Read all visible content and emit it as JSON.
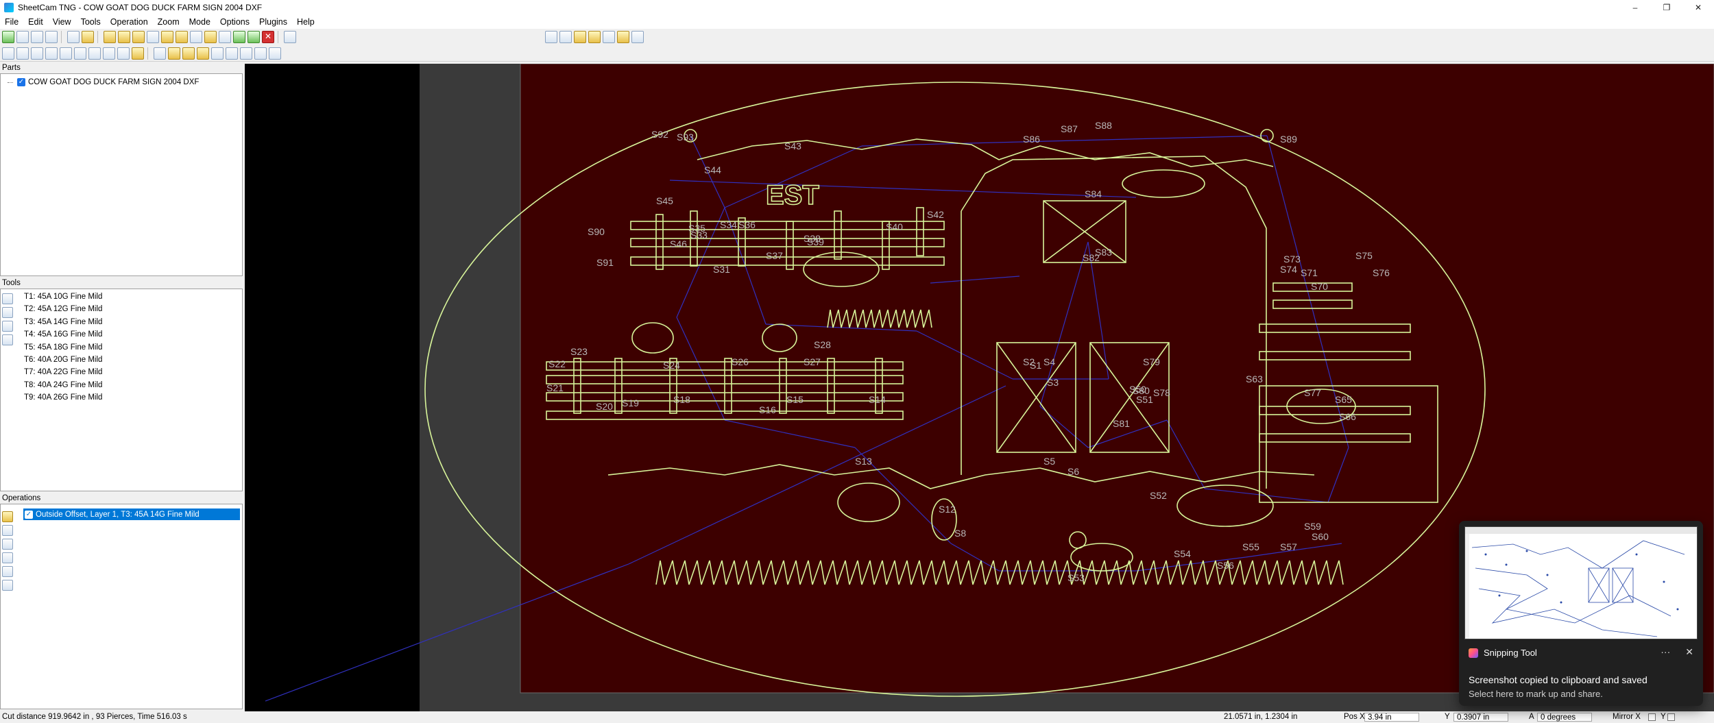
{
  "window": {
    "title": "SheetCam TNG - COW GOAT DOG DUCK FARM SIGN 2004 DXF",
    "controls": [
      "–",
      "❐",
      "✕"
    ]
  },
  "menu": [
    "File",
    "Edit",
    "View",
    "Tools",
    "Operation",
    "Zoom",
    "Mode",
    "Options",
    "Plugins",
    "Help"
  ],
  "parts": {
    "header": "Parts",
    "items": [
      {
        "label": "COW GOAT DOG DUCK FARM SIGN 2004 DXF",
        "checked": true
      }
    ]
  },
  "tools": {
    "header": "Tools",
    "items": [
      "T1: 45A 10G Fine Mild",
      "T2: 45A 12G Fine Mild",
      "T3: 45A 14G Fine Mild",
      "T4: 45A 16G Fine Mild",
      "T5: 45A 18G Fine Mild",
      "T6: 40A 20G Fine Mild",
      "T7: 40A 22G Fine Mild",
      "T8: 40A 24G Fine Mild",
      "T9: 40A 26G Fine Mild"
    ]
  },
  "operations": {
    "header": "Operations",
    "items": [
      {
        "label": "Outside Offset, Layer 1, T3: 45A 14G Fine Mild",
        "checked": true,
        "selected": true
      }
    ]
  },
  "drawing": {
    "est_label": "EST",
    "path_labels": [
      "S1",
      "S2",
      "S3",
      "S4",
      "S5",
      "S6",
      "S8",
      "S12",
      "S13",
      "S14",
      "S15",
      "S16",
      "S18",
      "S19",
      "S20",
      "S21",
      "S22",
      "S23",
      "S24",
      "S26",
      "S27",
      "S28",
      "S31",
      "S33",
      "S34",
      "S35",
      "S36",
      "S37",
      "S38",
      "S39",
      "S40",
      "S42",
      "S43",
      "S44",
      "S45",
      "S46",
      "S50",
      "S51",
      "S52",
      "S53",
      "S54",
      "S55",
      "S56",
      "S57",
      "S59",
      "S60",
      "S63",
      "S65",
      "S66",
      "S70",
      "S71",
      "S73",
      "S74",
      "S75",
      "S76",
      "S77",
      "S78",
      "S79",
      "S80",
      "S81",
      "S82",
      "S83",
      "S84",
      "S86",
      "S87",
      "S88",
      "S89",
      "S90",
      "S91",
      "S92",
      "S93"
    ],
    "colors": {
      "background": "#000000",
      "margin": "#3a3a3a",
      "sheet": "#3d0000",
      "outline": "#d8f59a",
      "rapid": "#3030c0",
      "label": "#b8b8b8"
    }
  },
  "status": {
    "cut_info": "Cut distance 919.9642 in , 93 Pierces, Time 516.03 s",
    "coords": "21.0571 in, 1.2304 in",
    "pos_x_label": "Pos X",
    "pos_x": "3.94 in",
    "y_label": "Y",
    "y": "0.3907 in",
    "angle_label": "A",
    "angle": "0 degrees",
    "mirror_label": "Mirror X",
    "mirror_y_label": "Y"
  },
  "toast": {
    "app": "Snipping Tool",
    "more": "···",
    "close": "✕",
    "message": "Screenshot copied to clipboard and saved",
    "sub": "Select here to mark up and share."
  }
}
